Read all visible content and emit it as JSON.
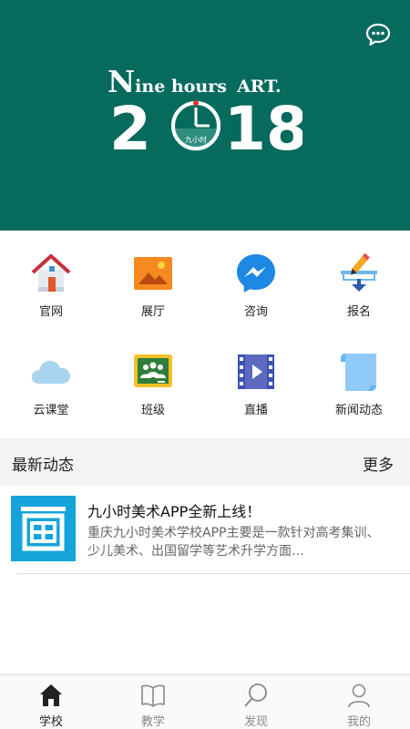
{
  "banner": {
    "brand_line_initial": "N",
    "brand_line_rest": "ine hours",
    "brand_line_art": "ART.",
    "year_left": "2",
    "year_right": "18",
    "seal_text": "九小时",
    "background_color": "#066a5d"
  },
  "chat_button": {
    "icon": "chat-bubble-icon"
  },
  "grid": {
    "items": [
      {
        "label": "官网",
        "icon": "house-icon"
      },
      {
        "label": "展厅",
        "icon": "picture-icon"
      },
      {
        "label": "咨询",
        "icon": "messenger-icon"
      },
      {
        "label": "报名",
        "icon": "pencil-download-icon"
      },
      {
        "label": "云课堂",
        "icon": "cloud-icon"
      },
      {
        "label": "班级",
        "icon": "classroom-board-icon"
      },
      {
        "label": "直播",
        "icon": "video-film-icon"
      },
      {
        "label": "新闻动态",
        "icon": "document-icon"
      }
    ]
  },
  "news_section": {
    "title": "最新动态",
    "more_label": "更多",
    "items": [
      {
        "title": "九小时美术APP全新上线！",
        "summary": "重庆九小时美术学校APP主要是一款针对高考集训、少儿美术、出国留学等艺术升学方面…",
        "thumb_icon": "painting-frame-icon",
        "thumb_color": "#14a4da"
      }
    ]
  },
  "tabbar": {
    "tabs": [
      {
        "label": "学校",
        "icon": "home-icon",
        "active": true
      },
      {
        "label": "教学",
        "icon": "book-icon",
        "active": false
      },
      {
        "label": "发现",
        "icon": "search-icon",
        "active": false
      },
      {
        "label": "我的",
        "icon": "person-icon",
        "active": false
      }
    ]
  }
}
